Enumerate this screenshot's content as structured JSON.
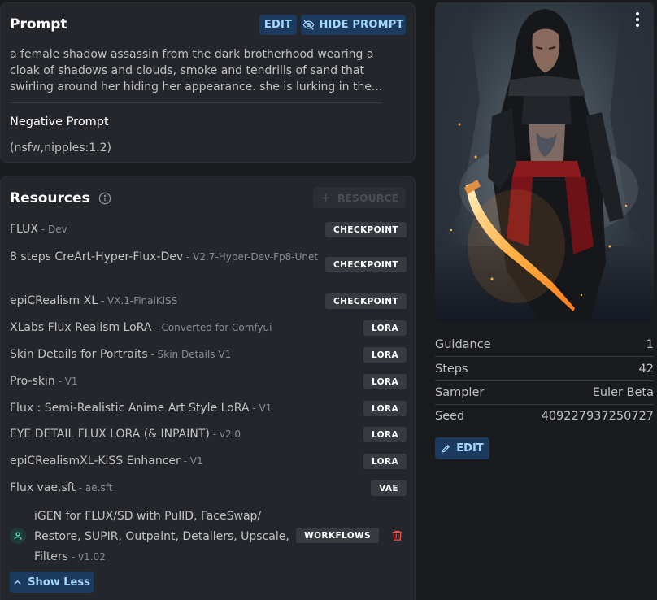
{
  "prompt": {
    "title": "Prompt",
    "edit_label": "EDIT",
    "hide_label": "HIDE PROMPT",
    "text": "a female shadow assassin from the dark brotherhood wearing a cloak of shadows and clouds, smoke and tendrills of sand that swirling around her hiding her appearance. she is lurking in the...",
    "negative_title": "Negative Prompt",
    "negative_text": "(nsfw,nipples:1.2)"
  },
  "resources": {
    "title": "Resources",
    "add_label": "RESOURCE",
    "show_less_label": "Show Less",
    "items": [
      {
        "name": "FLUX",
        "version": "Dev",
        "badge": "CHECKPOINT"
      },
      {
        "name": "8 steps CreArt-Hyper-Flux-Dev",
        "version": "V2.7-Hyper-Dev-Fp8-Unet",
        "badge": "CHECKPOINT"
      },
      {
        "name": "epiCRealism XL",
        "version": "VX.1-FinalKiSS",
        "badge": "CHECKPOINT"
      },
      {
        "name": "XLabs Flux Realism LoRA",
        "version": "Converted for Comfyui",
        "badge": "LORA"
      },
      {
        "name": "Skin Details for Portraits",
        "version": "Skin Details V1",
        "badge": "LORA"
      },
      {
        "name": "Pro-skin",
        "version": "V1",
        "badge": "LORA"
      },
      {
        "name": "Flux : Semi-Realistic Anime Art Style LoRA",
        "version": "V1",
        "badge": "LORA"
      },
      {
        "name": "EYE DETAIL FLUX LORA (& INPAINT)",
        "version": "v2.0",
        "badge": "LORA"
      },
      {
        "name": "epiCRealismXL-KiSS Enhancer",
        "version": "V1",
        "badge": "LORA"
      },
      {
        "name": "Flux vae.sft",
        "version": "ae.sft",
        "badge": "VAE"
      },
      {
        "name": "iGEN for FLUX/SD with PulID, FaceSwap/ Restore, SUPIR, Outpaint, Detailers, Upscale, Filters",
        "version": "v1.02",
        "badge": "WORKFLOWS"
      }
    ]
  },
  "params": {
    "guidance_label": "Guidance",
    "guidance_value": "1",
    "steps_label": "Steps",
    "steps_value": "42",
    "sampler_label": "Sampler",
    "sampler_value": "Euler Beta",
    "seed_label": "Seed",
    "seed_value": "409227937250727",
    "edit_label": "EDIT"
  },
  "colors": {
    "accent_bg": "#1c3a5e",
    "accent_text": "#a5d8ff",
    "delete_red": "#fa5252",
    "sword_glow": "#ffb347"
  },
  "icons": [
    "eye-off-icon",
    "info-icon",
    "plus-icon",
    "user-icon",
    "trash-icon",
    "chevron-up-icon",
    "pencil-icon",
    "dots-vertical-icon"
  ]
}
